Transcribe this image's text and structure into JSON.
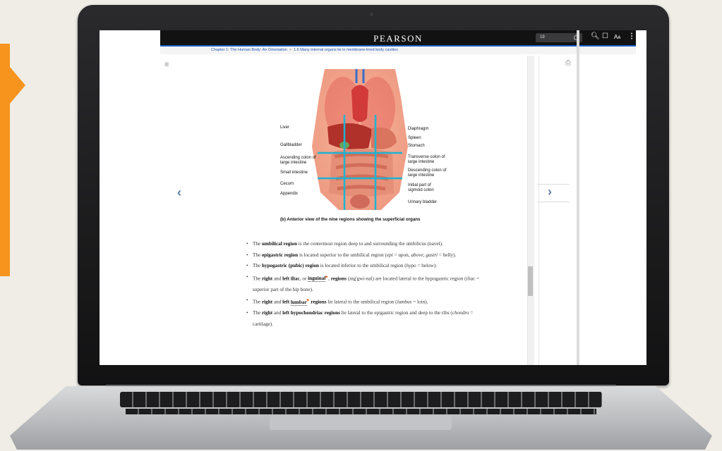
{
  "app": {
    "brand": "PEARSON",
    "page_input": "19"
  },
  "breadcrumb": {
    "chapter": "Chapter 1: The Human Body: An Orientation",
    "separator": ">",
    "section": "1.6 Many internal organs lie in membrane-lined body cavities"
  },
  "figure": {
    "labels_left": [
      "Liver",
      "Gallbladder",
      "Ascending colon of large intestine",
      "Small intestine",
      "Cecum",
      "Appendix"
    ],
    "labels_right": [
      "Diaphragm",
      "Spleen",
      "Stomach",
      "Transverse colon of large intestine",
      "Descending colon of large intestine",
      "Initial part of sigmoid colon",
      "Urinary bladder"
    ],
    "caption": "(b) Anterior view of the nine regions showing the superficial organs"
  },
  "bullets": {
    "b1": {
      "term": "umbilical region",
      "pre": "The ",
      "post": " is the centermost region deep to and surrounding the umbilicus (navel)."
    },
    "b2": {
      "pre": "The ",
      "term": "epigastric region",
      "mid": " is located superior to the umbilical region (",
      "i1": "epi",
      "m2": " = upon, ",
      "i2": "above",
      "m3": "; ",
      "i3": "gastri",
      "post": " = belly)."
    },
    "b3": {
      "pre": "The ",
      "term": "hypogastric (pubic) region",
      "mid": " is located inferior to the umbilical region (",
      "i1": "hypo",
      "post": " = below)."
    },
    "b4": {
      "pre": "The ",
      "t1": "right",
      "a1": " and ",
      "t2": "left iliac",
      "a2": ", or ",
      "t3": "inguinal",
      "a3": ", ",
      "t4": "regions",
      "mid": " (ing'gwi-nal) are located lateral to the hypogastric region (",
      "i1": "iliac",
      "post": " = superior part of the hip bone)."
    },
    "b5": {
      "pre": "The ",
      "t1": "right",
      "a1": " and ",
      "t2": "left ",
      "t3": "lumbar",
      "t4": " regions",
      "mid": " lie lateral to the umbilical region (",
      "i1": "lumbus",
      "post": " = loin)."
    },
    "b6": {
      "pre": "The ",
      "t1": "right",
      "a1": " and ",
      "t2": "left hypochondriac regions",
      "mid": " lie lateral to the epigastric region and deep to the ribs (",
      "i1": "chondro",
      "post": " = cartilage)."
    }
  },
  "icons": {
    "menu": "hamburger-menu-icon",
    "print": "print-icon",
    "search": "search-icon",
    "bookmark": "bookmark-icon",
    "font": "font-size-icon",
    "more": "more-vertical-icon"
  },
  "colors": {
    "accent_orange": "#f7941d",
    "link_blue": "#1a5fc7",
    "gridline_cyan": "#1fb3d1"
  }
}
